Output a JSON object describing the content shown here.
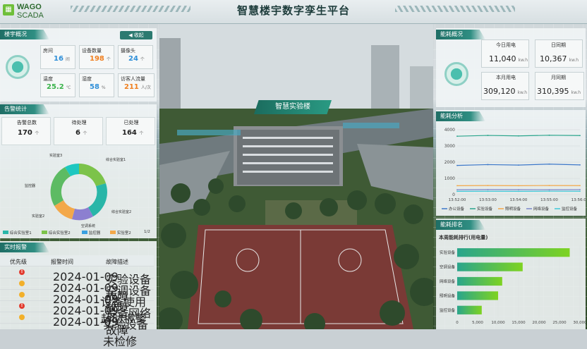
{
  "header": {
    "logo_line1": "WAGO",
    "logo_line2": "SCADA",
    "title": "智慧楼宇数字孪生平台"
  },
  "building_overview": {
    "title": "楼宇概况",
    "collapse_label": "收起",
    "stats": [
      {
        "label": "房间",
        "value": "16",
        "unit": "间",
        "color": "#2f8fd8"
      },
      {
        "label": "设备数量",
        "value": "198",
        "unit": "个",
        "color": "#f07f1f"
      },
      {
        "label": "摄像头",
        "value": "24",
        "unit": "个",
        "color": "#2f8fd8"
      },
      {
        "label": "温度",
        "value": "25.2",
        "unit": "℃",
        "color": "#3ab34a"
      },
      {
        "label": "湿度",
        "value": "58",
        "unit": "%",
        "color": "#2f8fd8"
      },
      {
        "label": "访客人流量",
        "value": "211",
        "unit": "人/次",
        "color": "#f07f1f"
      }
    ]
  },
  "alarm_stats": {
    "title": "告警统计",
    "boxes": [
      {
        "label": "告警总数",
        "value": "170",
        "unit": "个"
      },
      {
        "label": "待处理",
        "value": "6",
        "unit": "个"
      },
      {
        "label": "已处理",
        "value": "164",
        "unit": "个"
      }
    ],
    "donut_labels": [
      "实验室3",
      "综合实验室1",
      "监控器",
      "实验室2",
      "综合实验室2",
      "空调系统"
    ],
    "legend": [
      "综合实验室1",
      "综合实验室2",
      "监控器",
      "实验室2"
    ],
    "page": "1/2",
    "colors": [
      "#29b6a8",
      "#7cc34a",
      "#3aa0e0",
      "#8c7fd0",
      "#f3a84a",
      "#1ec7c0"
    ]
  },
  "realtime_alarms": {
    "title": "实时报警",
    "columns": [
      "优先级",
      "报警时间",
      "故障描述"
    ],
    "rows": [
      {
        "priority": "high",
        "time": "2024-01-09",
        "desc": "实验设备故障"
      },
      {
        "priority": "mid",
        "time": "2024-01-09",
        "desc": "空调设备故障"
      },
      {
        "priority": "mid",
        "time": "2024-01-09",
        "desc": "设备使用超时报警"
      },
      {
        "priority": "high",
        "time": "2024-01-09",
        "desc": "设备网络故障"
      },
      {
        "priority": "mid",
        "time": "2024-01-09",
        "desc": "实验设备未检修"
      }
    ]
  },
  "scene": {
    "building_label": "智慧实验楼"
  },
  "energy_overview": {
    "title": "能耗概况",
    "stats": [
      {
        "label": "今日用电",
        "value": "11,040",
        "unit": "kw.h"
      },
      {
        "label": "日同期",
        "value": "10,367",
        "unit": "kw.h"
      },
      {
        "label": "本月用电",
        "value": "309,120",
        "unit": "kw.h"
      },
      {
        "label": "月同期",
        "value": "310,395",
        "unit": "kw.h"
      }
    ]
  },
  "energy_analysis": {
    "title": "能耗分析",
    "legend": [
      "办公设备",
      "实验设备",
      "照明设备",
      "网络设备",
      "监控设备"
    ],
    "colors": [
      "#3d78c9",
      "#2aa58c",
      "#f3a84a",
      "#7a86c9",
      "#3ec8d9"
    ]
  },
  "chart_data": [
    {
      "type": "line",
      "x": [
        "13:52:00",
        "13:53:00",
        "13:54:00",
        "13:55:00",
        "13:56:00"
      ],
      "ylim": [
        0,
        4000
      ],
      "yticks": [
        "0",
        "1000",
        "2000",
        "3000",
        "4000"
      ],
      "series": [
        {
          "name": "办公设备",
          "values": [
            1800,
            1850,
            1820,
            1880,
            1830
          ]
        },
        {
          "name": "实验设备",
          "values": [
            3600,
            3650,
            3620,
            3660,
            3640
          ]
        },
        {
          "name": "照明设备",
          "values": [
            550,
            560,
            550,
            560,
            555
          ]
        },
        {
          "name": "网络设备",
          "values": [
            300,
            310,
            305,
            300,
            308
          ]
        },
        {
          "name": "监控设备",
          "values": [
            200,
            205,
            200,
            210,
            205
          ]
        }
      ]
    },
    {
      "type": "bar",
      "orientation": "horizontal",
      "title": "本周能耗排行(用电量)",
      "categories": [
        "实验设备",
        "空调设备",
        "网络设备",
        "照明设备",
        "监控设备"
      ],
      "values": [
        27500,
        16000,
        11000,
        10000,
        6000
      ],
      "xticks": [
        "0",
        "5,000",
        "10,000",
        "15,000",
        "20,000",
        "25,000",
        "30,000"
      ],
      "xlim": [
        0,
        30000
      ]
    }
  ],
  "energy_ranking": {
    "title": "能耗排名",
    "subtitle": "本周能耗排行(用电量)"
  }
}
